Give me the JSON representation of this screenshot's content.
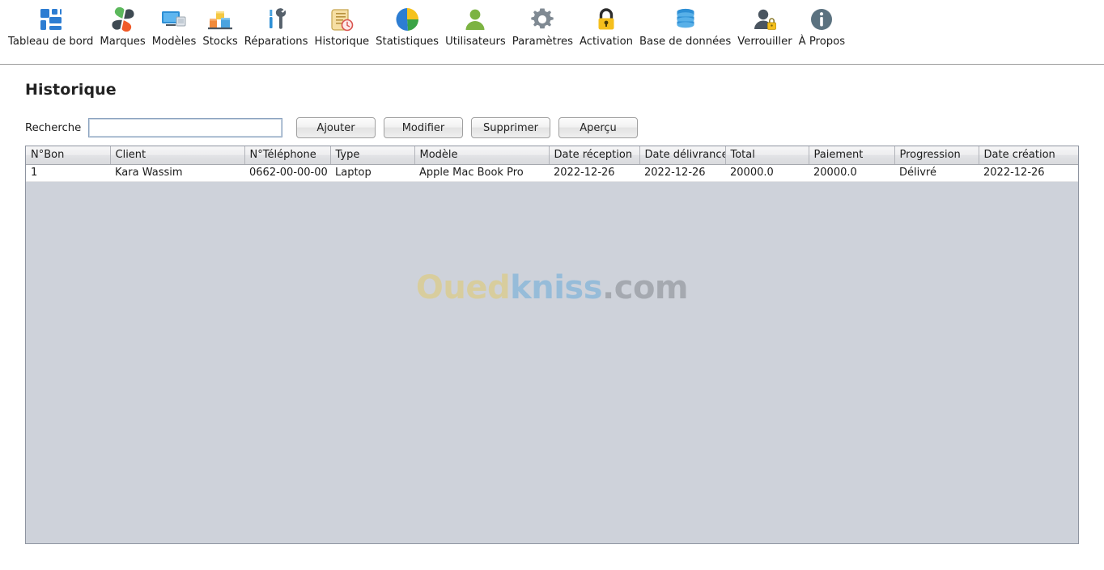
{
  "toolbar": {
    "items": [
      {
        "label": "Tableau de bord",
        "icon": "dashboard-icon"
      },
      {
        "label": "Marques",
        "icon": "brands-icon"
      },
      {
        "label": "Modèles",
        "icon": "models-icon"
      },
      {
        "label": "Stocks",
        "icon": "stock-icon"
      },
      {
        "label": "Réparations",
        "icon": "repairs-icon"
      },
      {
        "label": "Historique",
        "icon": "history-icon"
      },
      {
        "label": "Statistiques",
        "icon": "statistics-icon"
      },
      {
        "label": "Utilisateurs",
        "icon": "users-icon"
      },
      {
        "label": "Paramètres",
        "icon": "settings-gear-icon"
      },
      {
        "label": "Activation",
        "icon": "lock-icon"
      },
      {
        "label": "Base de données",
        "icon": "database-icon"
      },
      {
        "label": "Verrouiller",
        "icon": "user-lock-icon"
      },
      {
        "label": "À Propos",
        "icon": "info-icon"
      }
    ]
  },
  "page": {
    "title": "Historique"
  },
  "search": {
    "label": "Recherche",
    "value": "",
    "placeholder": ""
  },
  "actions": {
    "add_label": "Ajouter",
    "edit_label": "Modifier",
    "delete_label": "Supprimer",
    "preview_label": "Aperçu"
  },
  "table": {
    "columns": [
      "N°Bon",
      "Client",
      "N°Téléphone",
      "Type",
      "Modèle",
      "Date réception",
      "Date délivrance",
      "Total",
      "Paiement",
      "Progression",
      "Date création"
    ],
    "rows": [
      [
        "1",
        "Kara Wassim",
        "0662-00-00-00",
        "Laptop",
        "Apple Mac Book Pro",
        "2022-12-26",
        "2022-12-26",
        "20000.0",
        "20000.0",
        "Délivré",
        "2022-12-26"
      ]
    ]
  },
  "watermark": {
    "part1": "Oued",
    "part2": "kniss",
    "part3": ".com",
    "color1": "#e8c84a",
    "color2": "#4a9fd8",
    "color3": "#6d7278"
  }
}
